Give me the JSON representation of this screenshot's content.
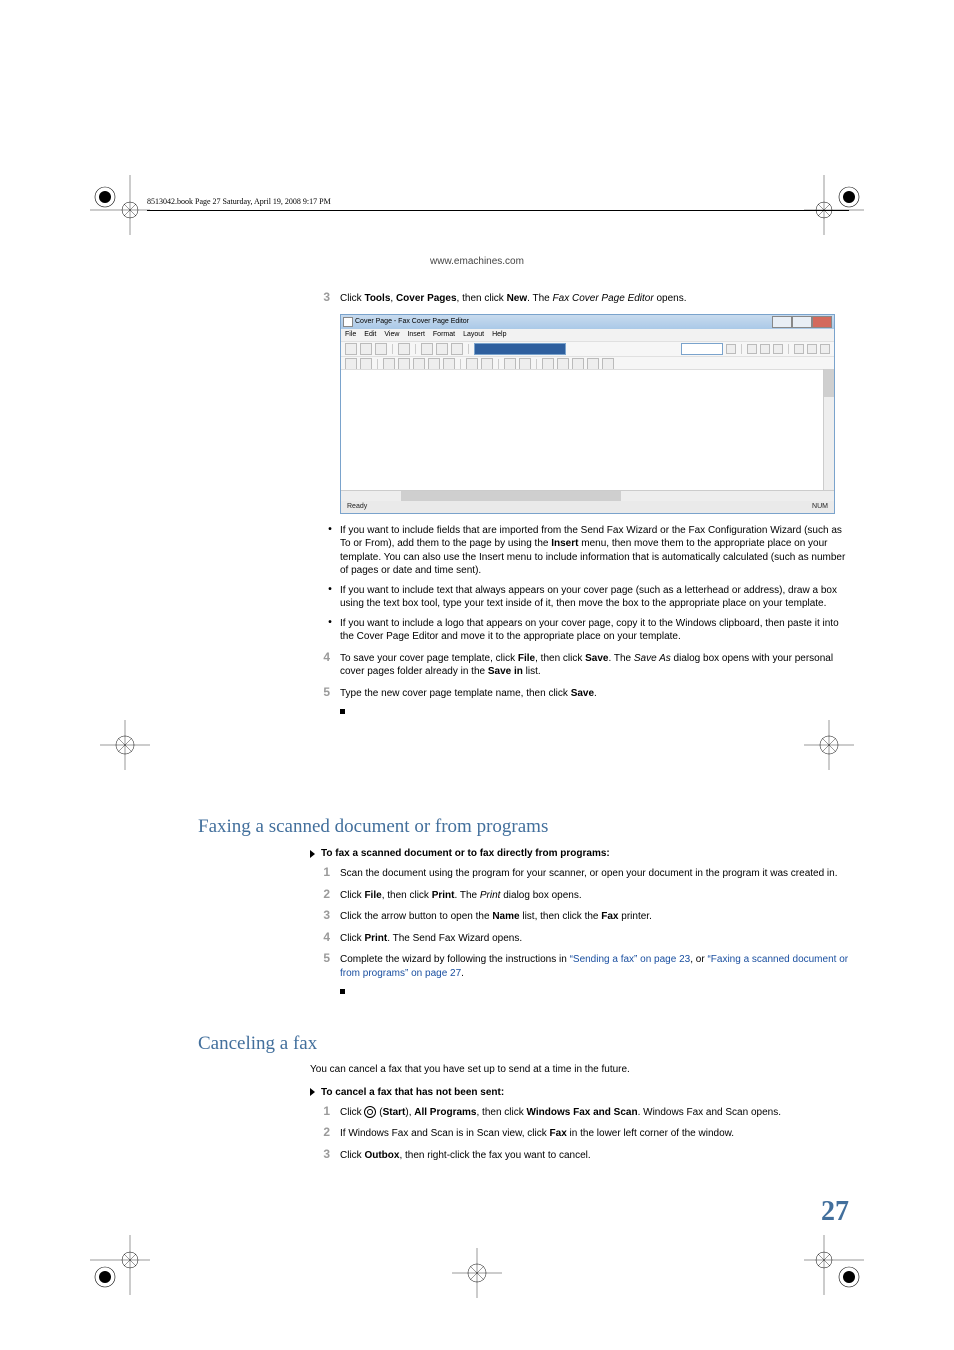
{
  "header": {
    "book_line": "8513042.book  Page 27  Saturday, April 19, 2008  9:17 PM",
    "url": "www.emachines.com"
  },
  "step3": {
    "num": "3",
    "pre": "Click ",
    "b1": "Tools",
    "mid1": ", ",
    "b2": "Cover Pages",
    "mid2": ", then click ",
    "b3": "New",
    "mid3": ". The ",
    "i1": "Fax Cover Page Editor",
    "post": " opens."
  },
  "screenshot": {
    "title": "Cover Page - Fax Cover Page Editor",
    "menus": [
      "File",
      "Edit",
      "View",
      "Insert",
      "Format",
      "Layout",
      "Help"
    ],
    "status_left": "Ready",
    "status_right": "NUM"
  },
  "bullets": [
    {
      "t1": "If you want to include fields that are imported from the Send Fax Wizard or the Fax Configuration Wizard (such as To or From), add them to the page by using the ",
      "b1": "Insert",
      "t2": " menu, then move them to the appropriate place on your template. You can also use the Insert menu to include information that is automatically calculated (such as number of pages or date and time sent)."
    },
    {
      "t1": "If you want to include text that always appears on your cover page (such as a letterhead or address), draw a box using the text box tool, type your text inside of it, then move the box to the appropriate place on your template."
    },
    {
      "t1": "If you want to include a logo that appears on your cover page, copy it to the Windows clipboard, then paste it into the Cover Page Editor and move it to the appropriate place on your template."
    }
  ],
  "step4": {
    "num": "4",
    "t1": "To save your cover page template, click ",
    "b1": "File",
    "t2": ", then click ",
    "b2": "Save",
    "t3": ". The ",
    "i1": "Save As",
    "t4": " dialog box opens with your personal cover pages folder already in the ",
    "b3": "Save in",
    "t5": " list."
  },
  "step5": {
    "num": "5",
    "t1": "Type the new cover page template name, then click ",
    "b1": "Save",
    "t2": "."
  },
  "sectionA": {
    "title": "Faxing a scanned document or from programs",
    "instr": "To fax a scanned document or to fax directly from programs:",
    "s1": {
      "num": "1",
      "t": "Scan the document using the program for your scanner, or open your document in the program it was created in."
    },
    "s2": {
      "num": "2",
      "t1": "Click ",
      "b1": "File",
      "t2": ", then click ",
      "b2": "Print",
      "t3": ". The ",
      "i1": "Print",
      "t4": " dialog box opens."
    },
    "s3": {
      "num": "3",
      "t1": "Click the arrow button to open the ",
      "b1": "Name",
      "t2": " list, then click the ",
      "b2": "Fax",
      "t3": " printer."
    },
    "s4": {
      "num": "4",
      "t1": "Click ",
      "b1": "Print",
      "t2": ". The Send Fax Wizard opens."
    },
    "s5": {
      "num": "5",
      "t1": "Complete the wizard by following the instructions in ",
      "l1": "“Sending a fax” on page 23",
      "t2": ", or ",
      "l2": "“Faxing a scanned document or from programs” on page 27",
      "t3": "."
    }
  },
  "sectionB": {
    "title": "Canceling a fax",
    "lead": "You can cancel a fax that you have set up to send at a time in the future.",
    "instr": "To cancel a fax that has not been sent:",
    "s1": {
      "num": "1",
      "t1": "Click ",
      "b1": "Start",
      "t2": "), ",
      "b2": "All Programs",
      "t3": ", then click ",
      "b3": "Windows Fax and Scan",
      "t4": ". Windows Fax and Scan opens.",
      "paren": " ("
    },
    "s2": {
      "num": "2",
      "t1": "If Windows Fax and Scan is in Scan view, click ",
      "b1": "Fax",
      "t2": " in the lower left corner of the window."
    },
    "s3": {
      "num": "3",
      "t1": "Click ",
      "b1": "Outbox",
      "t2": ", then right-click the fax you want to cancel."
    }
  },
  "page_num": "27"
}
